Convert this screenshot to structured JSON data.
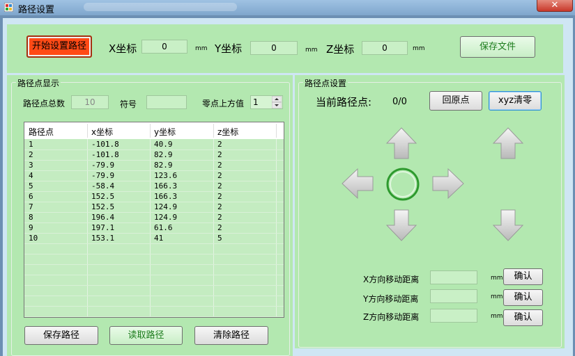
{
  "window": {
    "title": "路径设置",
    "close": "✕"
  },
  "top": {
    "start_button": "开始设置路径",
    "x_label": "X坐标",
    "x_value": "0",
    "x_unit": "mm",
    "y_label": "Y坐标",
    "y_value": "0",
    "y_unit": "mm",
    "z_label": "Z坐标",
    "z_value": "0",
    "z_unit": "mm",
    "save_file": "保存文件"
  },
  "left": {
    "group_title": "路径点显示",
    "total_label": "路径点总数",
    "total_value": "10",
    "symbol_label": "符号",
    "symbol_value": "",
    "zero_label": "零点上方值",
    "zero_value": "1",
    "columns": [
      "路径点",
      "x坐标",
      "y坐标",
      "z坐标"
    ],
    "rows": [
      [
        "1",
        "-101.8",
        "40.9",
        "2"
      ],
      [
        "2",
        "-101.8",
        "82.9",
        "2"
      ],
      [
        "3",
        "-79.9",
        "82.9",
        "2"
      ],
      [
        "4",
        "-79.9",
        "123.6",
        "2"
      ],
      [
        "5",
        "-58.4",
        "166.3",
        "2"
      ],
      [
        "6",
        "152.5",
        "166.3",
        "2"
      ],
      [
        "7",
        "152.5",
        "124.9",
        "2"
      ],
      [
        "8",
        "196.4",
        "124.9",
        "2"
      ],
      [
        "9",
        "197.1",
        "61.6",
        "2"
      ],
      [
        "10",
        "153.1",
        "41",
        "5"
      ]
    ],
    "save_path": "保存路径",
    "read_path": "读取路径",
    "clear_path": "清除路径"
  },
  "right": {
    "group_title": "路径点设置",
    "current_label": "当前路径点:",
    "current_value": "0/0",
    "home_button": "回原点",
    "xyz_reset_button": "xyz清零",
    "x_move_label": "X方向移动距离",
    "y_move_label": "Y方向移动距离",
    "z_move_label": "Z方向移动距离",
    "x_move_value": "",
    "y_move_value": "",
    "z_move_value": "",
    "unit": "mm",
    "confirm": "确认"
  }
}
